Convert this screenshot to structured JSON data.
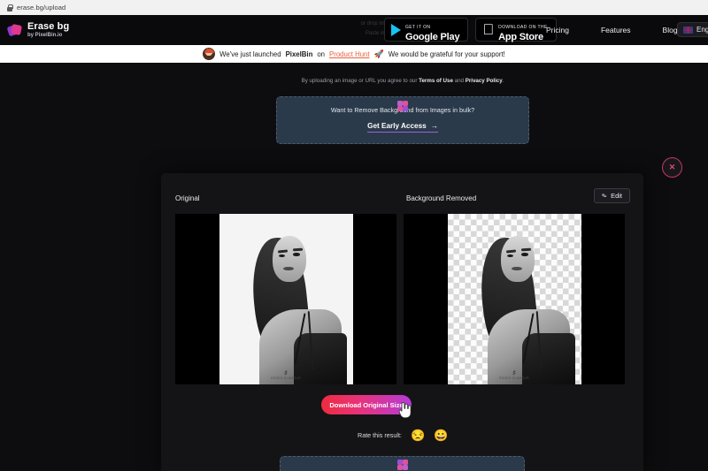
{
  "browser": {
    "url": "erase.bg/upload",
    "lock_icon": "lock-icon"
  },
  "header": {
    "brand_title": "Erase bg",
    "brand_subtitle": "by PixelBin.io",
    "ghost_hint_1": "or drop image anywhere",
    "ghost_hint_2": "Paste image or URL",
    "badges": [
      {
        "sub": "GET IT ON",
        "main": "Google Play",
        "icon": "google-play-icon"
      },
      {
        "sub": "Download on the",
        "main": "App Store",
        "icon": "apple-icon"
      }
    ],
    "nav": [
      {
        "label": "Pricing"
      },
      {
        "label": "Features"
      },
      {
        "label": "Blog"
      }
    ],
    "language": {
      "label": "English",
      "flag": "uk-flag-icon"
    }
  },
  "announcement": {
    "avatar": "product-hunt-avatar",
    "text_1": "We've just launched",
    "brand": "PixelBin",
    "text_2": "on",
    "link": "Product Hunt",
    "rocket": "🚀",
    "text_3": "We would be grateful for your support!"
  },
  "upload_section": {
    "legal_prefix": "By uploading an image or URL you agree to our",
    "legal_terms": "Terms of Use",
    "legal_and": "and",
    "legal_privacy": "Privacy Policy",
    "legal_end": "."
  },
  "bulk_card": {
    "icon": "pixelbin-x-icon",
    "question": "Want to Remove Background from Images in bulk?",
    "cta": "Get Early Access",
    "cta_arrow": "→"
  },
  "modal": {
    "close_label": "✕",
    "close_icon": "close-icon",
    "original_label": "Original",
    "removed_label": "Background Removed",
    "edit_label": "Edit",
    "edit_icon": "pencil-icon",
    "original_image": {
      "alt": "black and white portrait of a woman on white background",
      "watermark": "EDGES GLAMOUR"
    },
    "removed_image": {
      "alt": "black and white portrait of a woman with transparent checkerboard background",
      "watermark": "EDGES GLAMOUR"
    },
    "download_label": "Download Original Size",
    "cursor_icon": "hand-cursor-icon",
    "rate_label": "Rate this result:",
    "rating_options": [
      {
        "emoji": "😒",
        "name": "unamused-face-emoji"
      },
      {
        "emoji": "😀",
        "name": "grinning-face-emoji"
      }
    ]
  },
  "bottom_card": {
    "icon": "pixelbin-x-icon"
  },
  "colors": {
    "accent_pink": "#e0388e",
    "accent_purple": "#8e3bd0",
    "download_gradient_start": "#ef2b3f",
    "download_gradient_end": "#b53bd6",
    "card_bg": "#2b3a4a",
    "page_bg": "#0d0d0f",
    "product_hunt_link": "#e8603c"
  }
}
